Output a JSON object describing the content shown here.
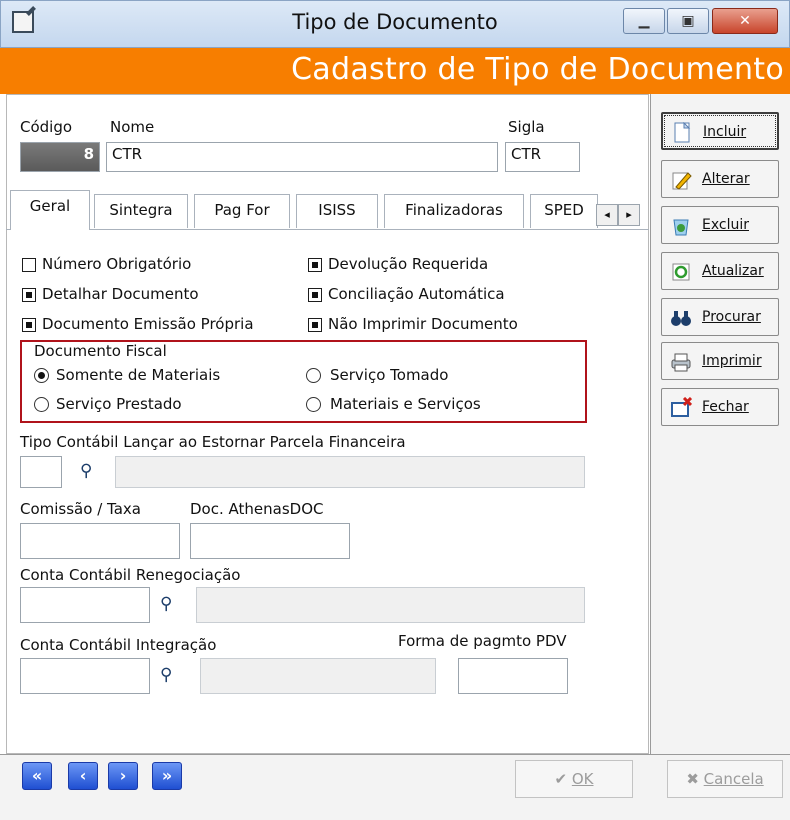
{
  "window": {
    "title": "Tipo de Documento",
    "header": "Cadastro de Tipo de Documento",
    "min_glyph": "▁",
    "max_glyph": "▣",
    "close_glyph": "✕"
  },
  "fields": {
    "codigo": {
      "label": "Código",
      "value": "8"
    },
    "nome": {
      "label": "Nome",
      "value": "CTR"
    },
    "sigla": {
      "label": "Sigla",
      "value": "CTR"
    }
  },
  "tabs": [
    "Geral",
    "Sintegra",
    "Pag For",
    "ISISS",
    "Finalizadoras",
    "SPED"
  ],
  "tab_arrows": {
    "left": "◂",
    "right": "▸"
  },
  "checkboxes": [
    {
      "label": "Número Obrigatório",
      "checked": false
    },
    {
      "label": "Devolução Requerida",
      "checked": true
    },
    {
      "label": "Detalhar Documento",
      "checked": true
    },
    {
      "label": "Conciliação Automática",
      "checked": true
    },
    {
      "label": "Documento Emissão Própria",
      "checked": true
    },
    {
      "label": "Não Imprimir Documento",
      "checked": true
    }
  ],
  "documento_fiscal": {
    "title": "Documento Fiscal",
    "options": [
      {
        "label": "Somente de Materiais",
        "selected": true
      },
      {
        "label": "Serviço Tomado",
        "selected": false
      },
      {
        "label": "Serviço Prestado",
        "selected": false
      },
      {
        "label": "Materiais e Serviços",
        "selected": false
      }
    ]
  },
  "form": {
    "tipo_contabil_label": "Tipo Contábil Lançar ao Estornar Parcela Financeira",
    "comissao_label": "Comissão / Taxa",
    "doc_athenas_label": "Doc. AthenasDOC",
    "conta_reneg_label": "Conta Contábil Renegociação",
    "conta_integ_label": "Conta Contábil Integração",
    "forma_pagto_label": "Forma de pagmto PDV",
    "binoculars_glyph": "⚲"
  },
  "side_buttons": [
    {
      "label": "Incluir",
      "icon": "new-document-icon"
    },
    {
      "label": "Alterar",
      "icon": "pencil-icon"
    },
    {
      "label": "Excluir",
      "icon": "recycle-bin-icon"
    },
    {
      "label": "Atualizar",
      "icon": "refresh-icon"
    },
    {
      "label": "Procurar",
      "icon": "binoculars-icon"
    },
    {
      "label": "Imprimir",
      "icon": "printer-icon"
    },
    {
      "label": "Fechar",
      "icon": "close-window-icon"
    }
  ],
  "nav": {
    "first": "«",
    "prev": "‹",
    "next": "›",
    "last": "»"
  },
  "bottom": {
    "ok": "OK",
    "cancel": "Cancela",
    "ok_glyph": "✔",
    "cancel_glyph": "✖"
  },
  "colors": {
    "header": "#f77e00",
    "fiscal_border": "#b0131b",
    "nav": "#1f4fd2"
  }
}
